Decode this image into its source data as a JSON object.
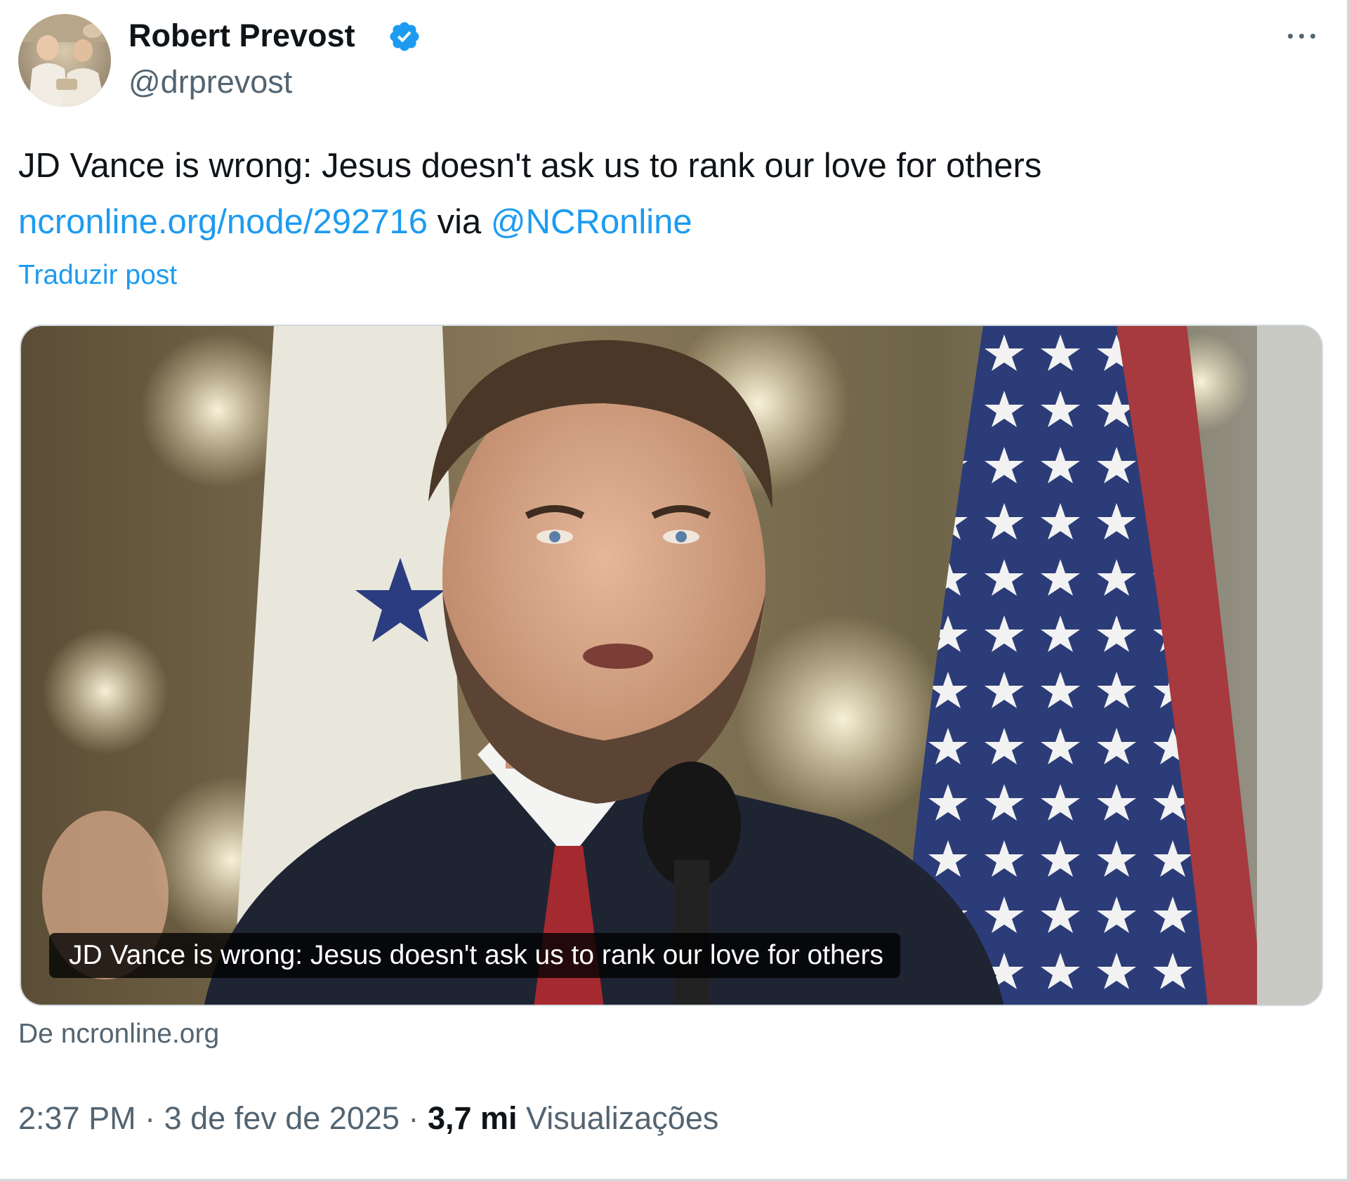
{
  "post": {
    "author_name": "Robert Prevost",
    "author_handle": "@drprevost",
    "text": "JD Vance is wrong: Jesus doesn't ask us to rank our love for others",
    "link_text": "ncronline.org/node/292716",
    "via_text": "via",
    "mention": "@NCRonline",
    "translate_label": "Traduzir post"
  },
  "card": {
    "caption": "JD Vance is wrong: Jesus doesn't ask us to rank our love for others",
    "source": "De ncronline.org"
  },
  "meta": {
    "time": "2:37 PM",
    "separator": "·",
    "date": "3 de fev de 2025",
    "views_count": "3,7 mi",
    "views_label": "Visualizações"
  },
  "icons": {
    "verified": "verified-badge-icon",
    "more": "more-options-icon"
  },
  "colors": {
    "link": "#1d9bf0",
    "secondary_text": "#536471",
    "primary_text": "#0f1419",
    "verified": "#1d9bf0"
  }
}
